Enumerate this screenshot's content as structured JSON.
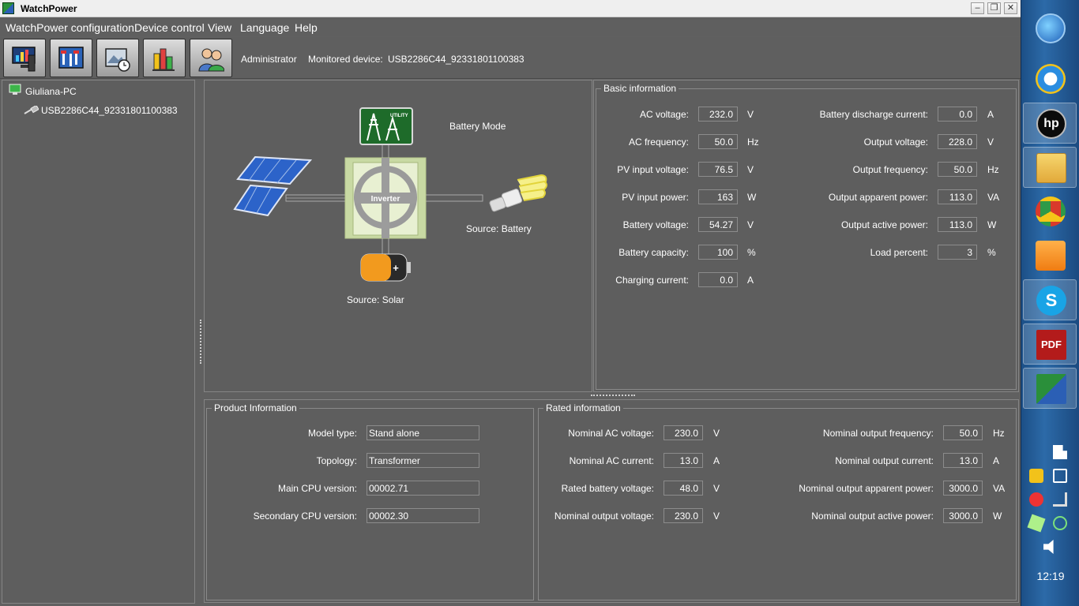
{
  "window": {
    "title": "WatchPower"
  },
  "menu": [
    "WatchPower configuration",
    "Device control",
    "View",
    "Language",
    "Help"
  ],
  "toolbar": {
    "user_label": "Administrator",
    "monitored_label": "Monitored device:",
    "monitored_value": "USB2286C44_92331801100383"
  },
  "tree": {
    "root": "Giuliana-PC",
    "device": "USB2286C44_92331801100383"
  },
  "flow": {
    "mode": "Battery Mode",
    "utility_label": "UTILITY",
    "inverter_label": "Inverter",
    "source_output": "Source:  Battery",
    "source_input": "Source:  Solar"
  },
  "basic": {
    "title": "Basic information",
    "left": [
      {
        "label": "AC voltage:",
        "value": "232.0",
        "unit": "V"
      },
      {
        "label": "AC frequency:",
        "value": "50.0",
        "unit": "Hz"
      },
      {
        "label": "PV input voltage:",
        "value": "76.5",
        "unit": "V"
      },
      {
        "label": "PV input power:",
        "value": "163",
        "unit": "W"
      },
      {
        "label": "Battery voltage:",
        "value": "54.27",
        "unit": "V"
      },
      {
        "label": "Battery capacity:",
        "value": "100",
        "unit": "%"
      },
      {
        "label": "Charging current:",
        "value": "0.0",
        "unit": "A"
      }
    ],
    "right": [
      {
        "label": "Battery discharge current:",
        "value": "0.0",
        "unit": "A"
      },
      {
        "label": "Output voltage:",
        "value": "228.0",
        "unit": "V"
      },
      {
        "label": "Output frequency:",
        "value": "50.0",
        "unit": "Hz"
      },
      {
        "label": "Output apparent power:",
        "value": "113.0",
        "unit": "VA"
      },
      {
        "label": "Output active power:",
        "value": "113.0",
        "unit": "W"
      },
      {
        "label": "Load percent:",
        "value": "3",
        "unit": "%"
      }
    ]
  },
  "product": {
    "title": "Product Information",
    "rows": [
      {
        "label": "Model type:",
        "value": "Stand alone"
      },
      {
        "label": "Topology:",
        "value": "Transformer"
      },
      {
        "label": "Main CPU version:",
        "value": "00002.71"
      },
      {
        "label": "Secondary CPU version:",
        "value": "00002.30"
      }
    ]
  },
  "rated": {
    "title": "Rated information",
    "left": [
      {
        "label": "Nominal AC voltage:",
        "value": "230.0",
        "unit": "V"
      },
      {
        "label": "Nominal AC current:",
        "value": "13.0",
        "unit": "A"
      },
      {
        "label": "Rated battery voltage:",
        "value": "48.0",
        "unit": "V"
      },
      {
        "label": "Nominal output voltage:",
        "value": "230.0",
        "unit": "V"
      }
    ],
    "right": [
      {
        "label": "Nominal output frequency:",
        "value": "50.0",
        "unit": "Hz"
      },
      {
        "label": "Nominal output current:",
        "value": "13.0",
        "unit": "A"
      },
      {
        "label": "Nominal output apparent power:",
        "value": "3000.0",
        "unit": "VA"
      },
      {
        "label": "Nominal output active power:",
        "value": "3000.0",
        "unit": "W"
      }
    ]
  },
  "taskbar": {
    "clock": "12:19",
    "pdf_label": "PDF",
    "hp_label": "hp"
  }
}
